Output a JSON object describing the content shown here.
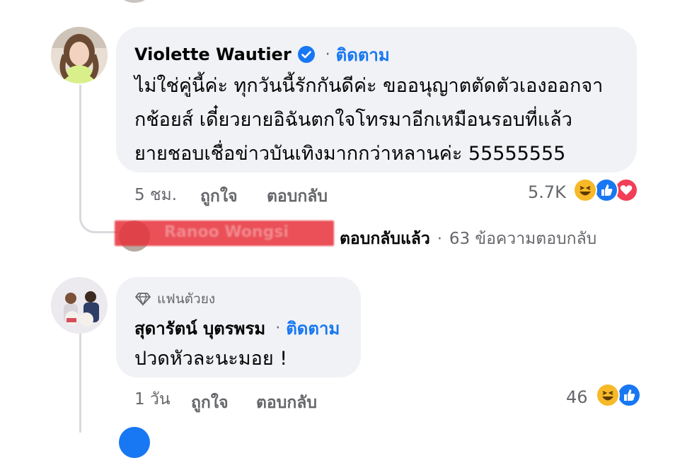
{
  "comment1": {
    "author": "Violette Wautier",
    "follow_label": "ติดตาม",
    "separator": "·",
    "lines": [
      "ไม่ใช่คู่นี้ค่ะ ทุกวันนี้รักกันดีค่ะ ขออนุญาตตัดตัวเองออกจา",
      "กช้อยส์ เดี๋ยวยายอิฉันตกใจโทรมาอีกเหมือนรอบที่แล้ว",
      "ยายชอบเชื่อข่าวบันเทิงมากกว่าหลานค่ะ 55555555"
    ],
    "time": "5 ชม.",
    "like_label": "ถูกใจ",
    "reply_label": "ตอบกลับ",
    "reaction_count": "5.7K",
    "reactions": [
      "haha",
      "like",
      "love"
    ]
  },
  "reply_summary": {
    "blurred_name": "Ranoo Wongsi",
    "replied_text": "ตอบกลับแล้ว",
    "separator": "·",
    "count_text": "63 ข้อความตอบกลับ"
  },
  "comment2": {
    "badge_label": "แฟนตัวยง",
    "author": "สุดารัตน์ บุตรพรม",
    "follow_label": "ติดตาม",
    "separator": "·",
    "text": "ปวดหัวละนะมอย !",
    "time": "1 วัน",
    "like_label": "ถูกใจ",
    "reply_label": "ตอบกลับ",
    "reaction_count": "46",
    "reactions": [
      "haha",
      "like"
    ]
  },
  "colors": {
    "accent": "#1877f2",
    "bubble": "#f0f2f5",
    "meta": "#65676b",
    "blur_red": "#e8313a"
  }
}
